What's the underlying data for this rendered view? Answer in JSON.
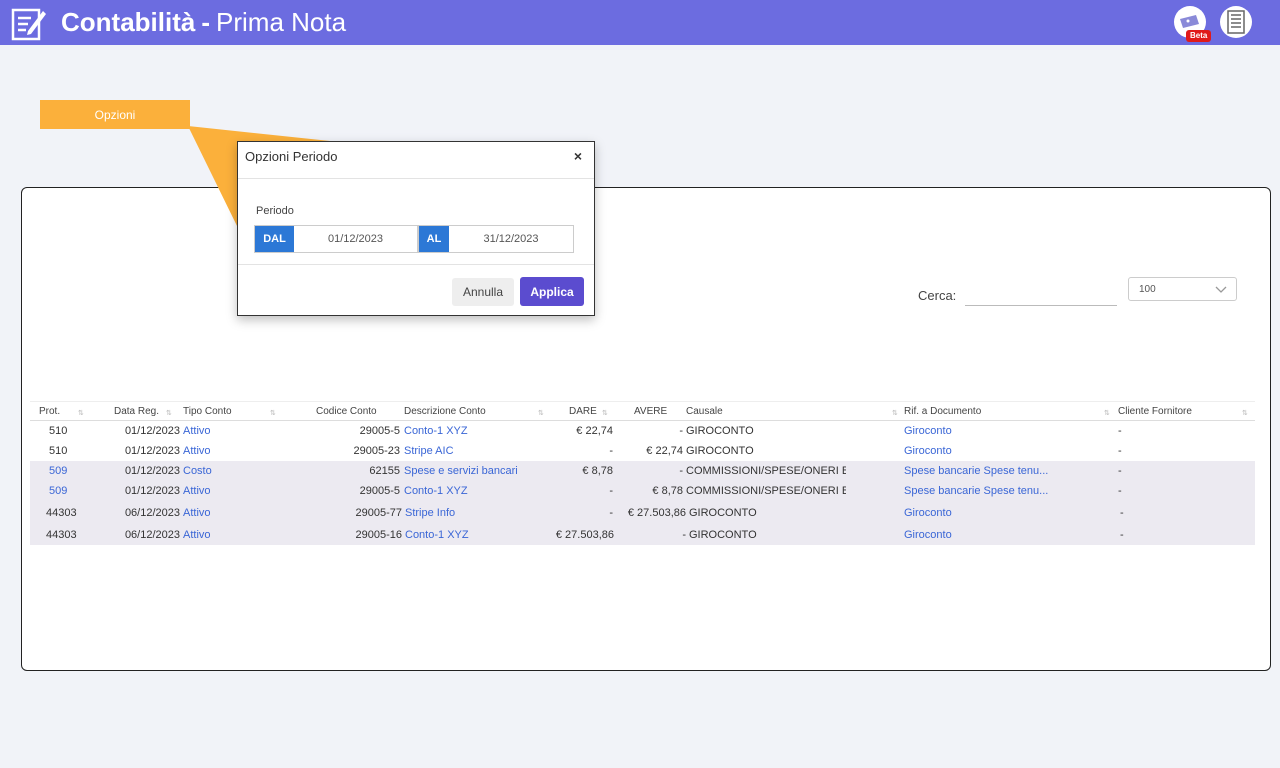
{
  "header": {
    "title_strong": "Contabilità",
    "title_sep": "-",
    "title_rest": "Prima Nota",
    "beta_badge": "Beta",
    "icons": [
      "edit-document-icon",
      "ticket-icon",
      "building-icon"
    ],
    "colors": {
      "topbar": "#6c6ce0",
      "callout": "#fbb03b",
      "accent": "#5b4ccf",
      "date_tag": "#2c78d6",
      "link": "#3a66d6"
    }
  },
  "callout": {
    "label": "Opzioni"
  },
  "search": {
    "label": "Cerca:",
    "value": ""
  },
  "page_size": {
    "selected": "100"
  },
  "table": {
    "columns": [
      "Prot.",
      "Data Reg.",
      "Tipo Conto",
      "Codice Conto",
      "Descrizione Conto",
      "DARE",
      "AVERE",
      "Causale",
      "Rif. a Documento",
      "Cliente Fornitore"
    ],
    "rows": [
      {
        "prot": "510",
        "data": "01/12/2023",
        "tipo": "Attivo",
        "codice": "29005-5",
        "descrizione": "Conto-1 XYZ",
        "dare": "€ 22,74",
        "avere": "-",
        "causale": "GIROCONTO",
        "rif": "Giroconto",
        "cliente": "-"
      },
      {
        "prot": "510",
        "data": "01/12/2023",
        "tipo": "Attivo",
        "codice": "29005-23",
        "descrizione": "Stripe AIC",
        "dare": "-",
        "avere": "€ 22,74",
        "causale": "GIROCONTO",
        "rif": "Giroconto",
        "cliente": "-"
      },
      {
        "prot": "509",
        "data": "01/12/2023",
        "tipo": "Costo",
        "codice": "62155",
        "descrizione": "Spese e servizi bancari",
        "dare": "€ 8,78",
        "avere": "-",
        "causale": "COMMISSIONI/SPESE/ONERI B...",
        "rif": "Spese bancarie Spese tenu...",
        "cliente": "-"
      },
      {
        "prot": "509",
        "data": "01/12/2023",
        "tipo": "Attivo",
        "codice": "29005-5",
        "descrizione": "Conto-1 XYZ",
        "dare": "-",
        "avere": "€ 8,78",
        "causale": "COMMISSIONI/SPESE/ONERI B...",
        "rif": "Spese bancarie Spese tenu...",
        "cliente": "-"
      },
      {
        "prot": "44303",
        "data": "06/12/2023",
        "tipo": "Attivo",
        "codice": "29005-77",
        "descrizione": "Stripe Info",
        "dare": "-",
        "avere": "€ 27.503,86",
        "causale": "GIROCONTO",
        "rif": "Giroconto",
        "cliente": "-"
      },
      {
        "prot": "44303",
        "data": "06/12/2023",
        "tipo": "Attivo",
        "codice": "29005-16",
        "descrizione": "Conto-1 XYZ",
        "dare": "€ 27.503,86",
        "avere": "-",
        "causale": "GIROCONTO",
        "rif": "Giroconto",
        "cliente": "-"
      }
    ]
  },
  "modal": {
    "title": "Opzioni Periodo",
    "close": "×",
    "periodo_label": "Periodo",
    "dal_label": "DAL",
    "dal_value": "01/12/2023",
    "al_label": "AL",
    "al_value": "31/12/2023",
    "cancel_label": "Annulla",
    "apply_label": "Applica"
  }
}
